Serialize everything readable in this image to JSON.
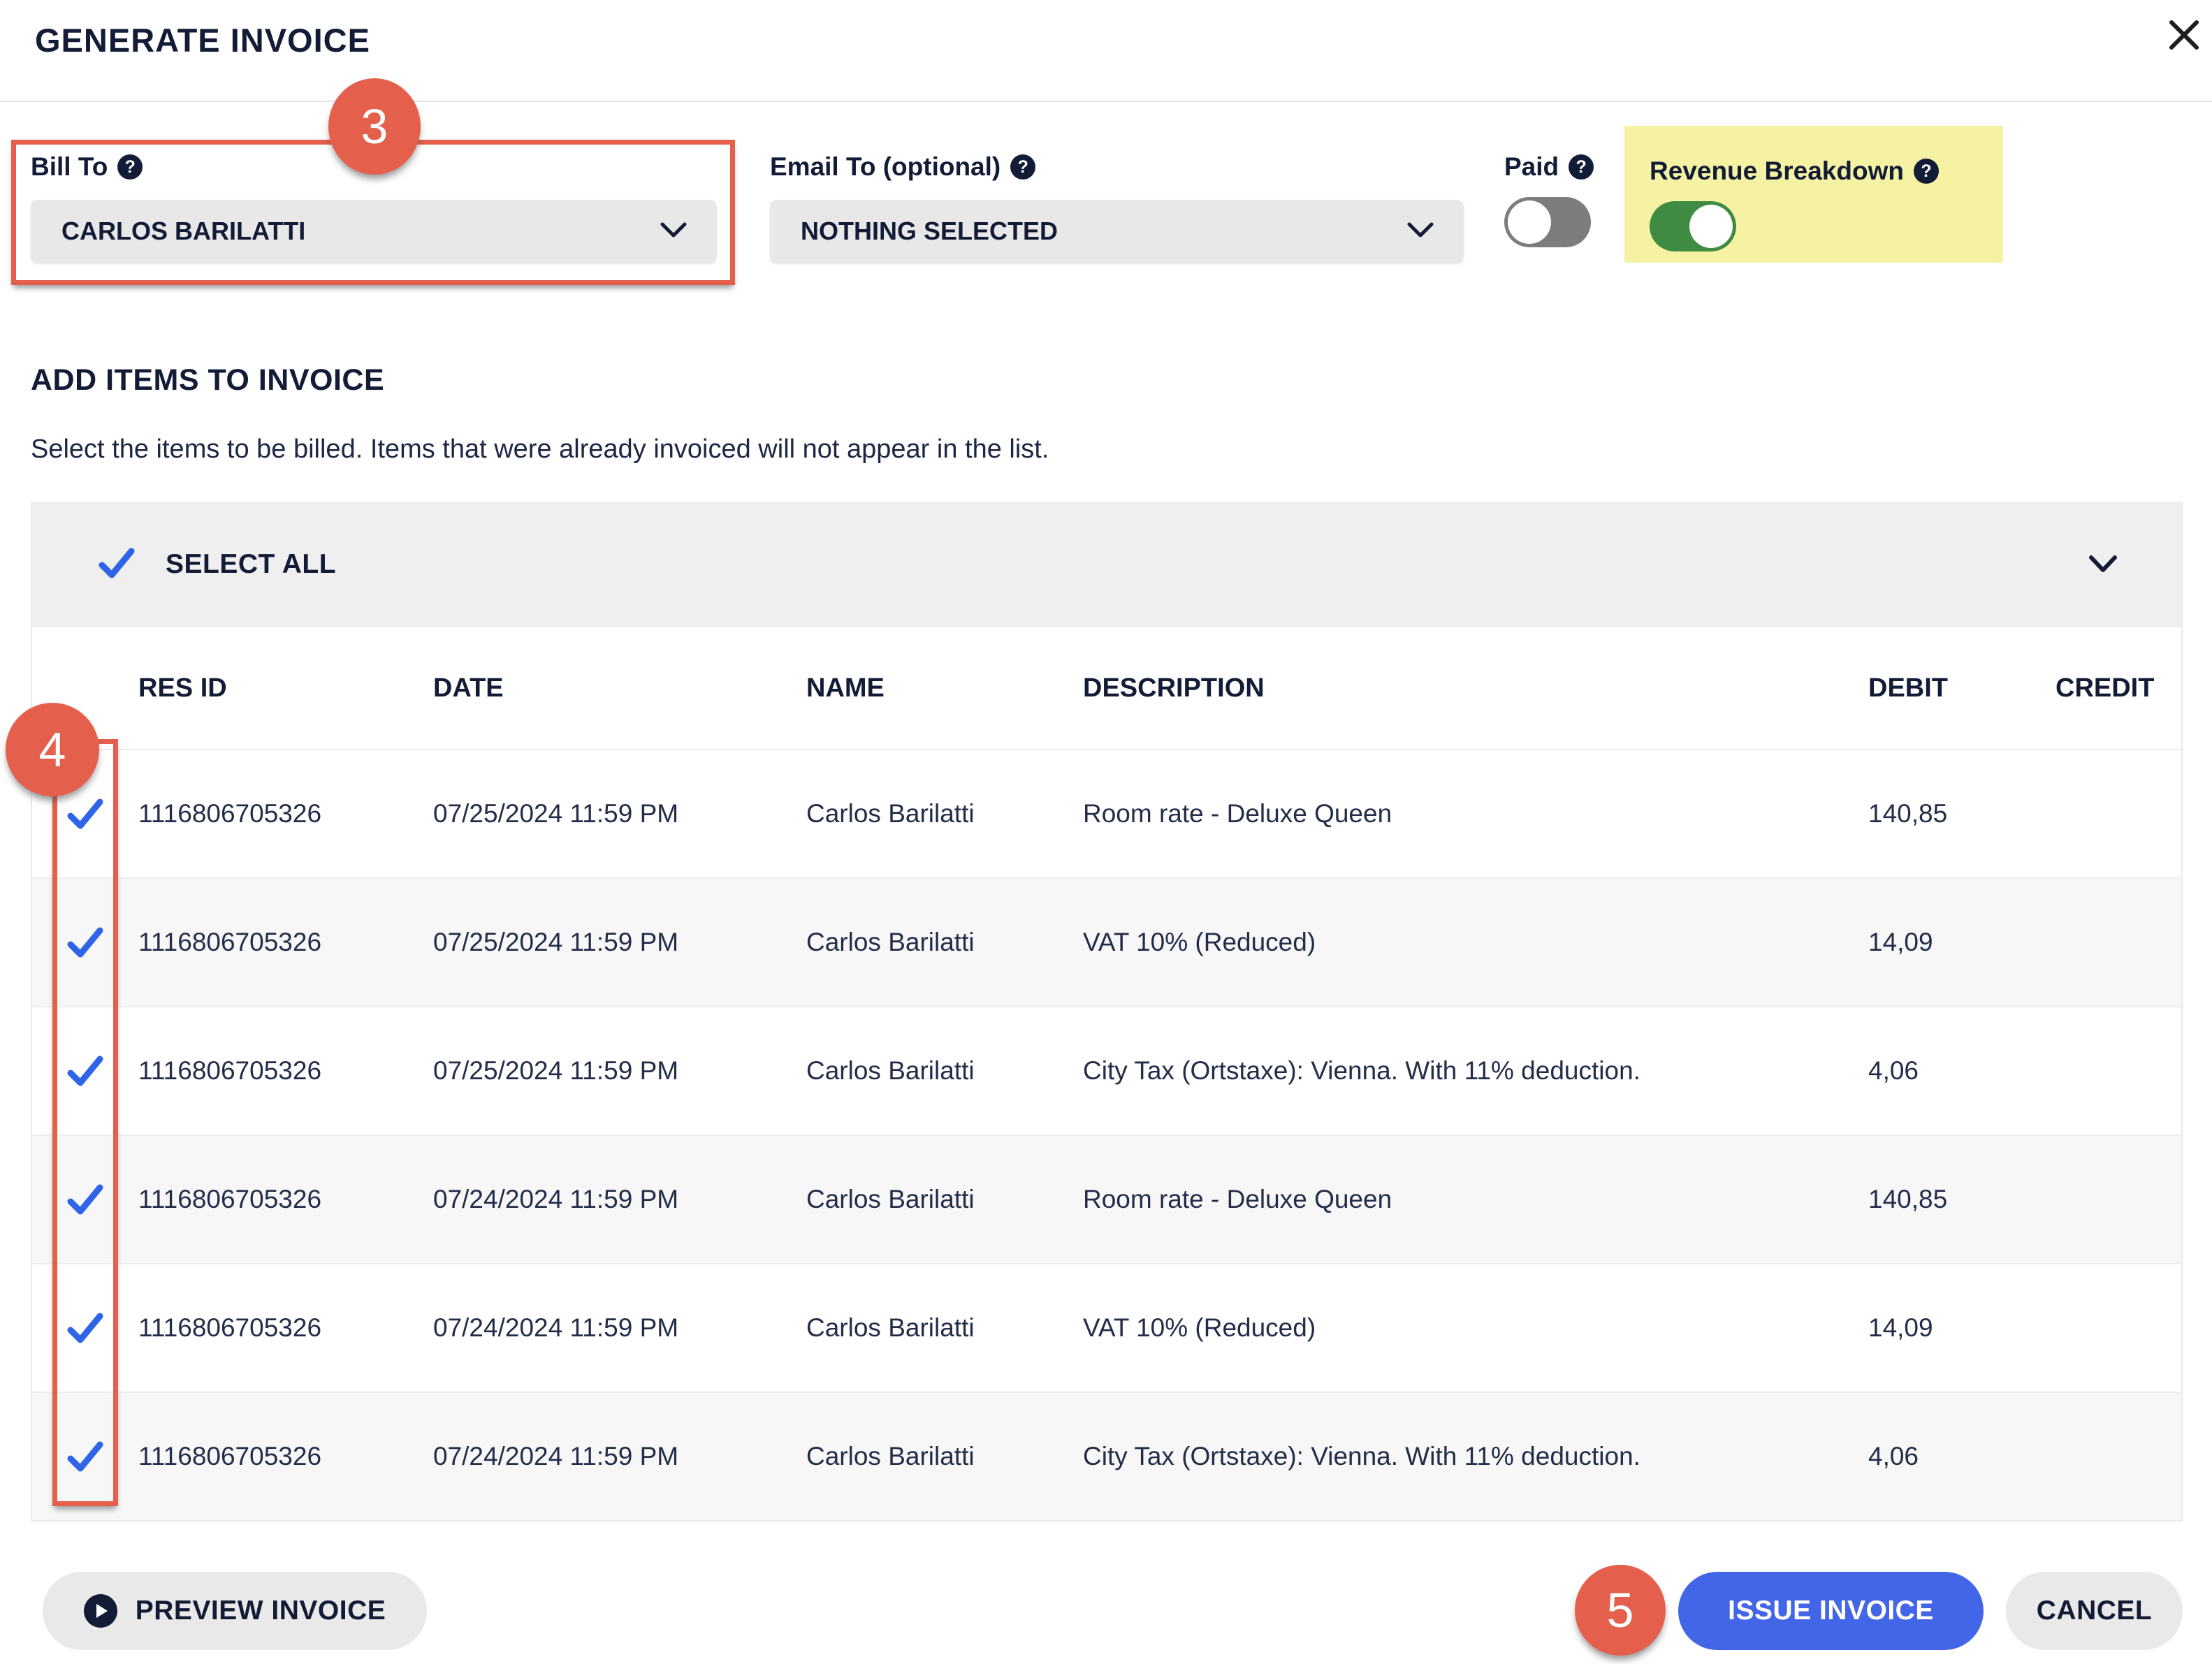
{
  "modal": {
    "title": "GENERATE INVOICE"
  },
  "form": {
    "bill_to": {
      "label": "Bill To",
      "value": "CARLOS BARILATTI"
    },
    "email_to": {
      "label": "Email To (optional)",
      "value": "NOTHING SELECTED"
    },
    "paid": {
      "label": "Paid",
      "state": "off"
    },
    "revenue_breakdown": {
      "label": "Revenue Breakdown",
      "state": "on"
    }
  },
  "items_section": {
    "heading": "ADD ITEMS TO INVOICE",
    "subtitle": "Select the items to be billed. Items that were already invoiced will not appear in the list.",
    "select_all_label": "SELECT ALL",
    "columns": {
      "res_id": "RES ID",
      "date": "DATE",
      "name": "NAME",
      "description": "DESCRIPTION",
      "debit": "DEBIT",
      "credit": "CREDIT"
    },
    "rows": [
      {
        "checked": true,
        "res_id": "1116806705326",
        "date": "07/25/2024 11:59 PM",
        "name": "Carlos Barilatti",
        "description": "Room rate - Deluxe Queen",
        "debit": "140,85",
        "credit": ""
      },
      {
        "checked": true,
        "res_id": "1116806705326",
        "date": "07/25/2024 11:59 PM",
        "name": "Carlos Barilatti",
        "description": "VAT 10% (Reduced)",
        "debit": "14,09",
        "credit": ""
      },
      {
        "checked": true,
        "res_id": "1116806705326",
        "date": "07/25/2024 11:59 PM",
        "name": "Carlos Barilatti",
        "description": "City Tax (Ortstaxe): Vienna. With 11% deduction.",
        "debit": "4,06",
        "credit": ""
      },
      {
        "checked": true,
        "res_id": "1116806705326",
        "date": "07/24/2024 11:59 PM",
        "name": "Carlos Barilatti",
        "description": "Room rate - Deluxe Queen",
        "debit": "140,85",
        "credit": ""
      },
      {
        "checked": true,
        "res_id": "1116806705326",
        "date": "07/24/2024 11:59 PM",
        "name": "Carlos Barilatti",
        "description": "VAT 10% (Reduced)",
        "debit": "14,09",
        "credit": ""
      },
      {
        "checked": true,
        "res_id": "1116806705326",
        "date": "07/24/2024 11:59 PM",
        "name": "Carlos Barilatti",
        "description": "City Tax (Ortstaxe): Vienna. With 11% deduction.",
        "debit": "4,06",
        "credit": ""
      }
    ]
  },
  "footer": {
    "preview_label": "PREVIEW INVOICE",
    "issue_label": "ISSUE INVOICE",
    "cancel_label": "CANCEL"
  },
  "annotations": {
    "step3": "3",
    "step4": "4",
    "step5": "5"
  },
  "colors": {
    "annotation_red": "#e4604c",
    "highlight_yellow": "#f6f2a3",
    "toggle_green": "#3e8b41",
    "toggle_gray": "#7d7d7d",
    "check_blue": "#2f63e8",
    "primary_button_blue": "#4366e8",
    "text_navy": "#131c36"
  }
}
